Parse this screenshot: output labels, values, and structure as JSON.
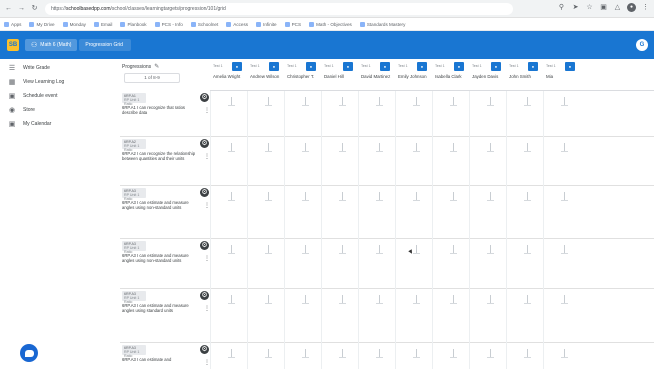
{
  "browser": {
    "url_prefix": "https://",
    "url_domain": "schoolbasedpp.com",
    "url_path": "/school/classes/learningtargets/progression/101/grid",
    "bookmarks": [
      {
        "label": "Apps",
        "icon": "apps-icon"
      },
      {
        "label": "My Drive",
        "icon": "drive-icon"
      },
      {
        "label": "Monday",
        "icon": "calendar-icon"
      },
      {
        "label": "Email",
        "icon": "mail-icon"
      },
      {
        "label": "Planbook",
        "icon": "book-icon"
      },
      {
        "label": "PCS - Info",
        "icon": "bookmark-icon"
      },
      {
        "label": "Schoolnet",
        "icon": "bookmark-icon"
      },
      {
        "label": "Access",
        "icon": "bookmark-icon"
      },
      {
        "label": "Infinite",
        "icon": "bookmark-icon"
      },
      {
        "label": "PCS",
        "icon": "bookmark-icon"
      },
      {
        "label": "Math - Objectives",
        "icon": "bookmark-icon"
      },
      {
        "label": "Standards Mastery",
        "icon": "bookmark-icon"
      }
    ]
  },
  "header": {
    "logo_text": "SB",
    "tab_label": "Math 6 (Math)",
    "subtab_label": "Progression Grid",
    "user_initial": "G"
  },
  "sidebar": {
    "items": [
      {
        "label": "Write Grade",
        "icon": "list-icon",
        "active": false
      },
      {
        "label": "View Learning Log",
        "icon": "log-icon",
        "active": false
      },
      {
        "label": "Schedule event",
        "icon": "calendar-icon",
        "active": false
      },
      {
        "label": "Store",
        "icon": "lock-icon",
        "active": false
      },
      {
        "label": "My Calendar",
        "icon": "calendar-icon",
        "active": false
      }
    ],
    "fab_icon": "chat-icon"
  },
  "progression": {
    "title": "Progressions",
    "select_value": "1 of 8-9"
  },
  "students": [
    {
      "label": "Test 1",
      "name": "Amelia Wright"
    },
    {
      "label": "Test 1",
      "name": "Andrew Wilson"
    },
    {
      "label": "Test 1",
      "name": "Christopher T."
    },
    {
      "label": "Test 1",
      "name": "Daniel Hill"
    },
    {
      "label": "Test 1",
      "name": "David Martinez"
    },
    {
      "label": "Test 1",
      "name": "Emily Johnson"
    },
    {
      "label": "Test 1",
      "name": "Isabella Clark"
    },
    {
      "label": "Test 1",
      "name": "Jayden Davis"
    },
    {
      "label": "Test 1",
      "name": "John Smith"
    },
    {
      "label": "Test 1",
      "name": "Mia"
    }
  ],
  "targets": [
    {
      "tag": "6RP.A1",
      "sub": "RP Unit 1 Ratio",
      "text": "6RP.A1 I can recognize that ratios describe data"
    },
    {
      "tag": "6RP.A2",
      "sub": "RP Unit 1 Ratio",
      "text": "6RP.A2 I can recognize the relationship between quantities and their units"
    },
    {
      "tag": "6RP.A3",
      "sub": "RP Unit 1 Ratio",
      "text": "6RP.A3 I can estimate and measure angles using non-standard units"
    },
    {
      "tag": "6RP.A3",
      "sub": "RP Unit 1 Ratio",
      "text": "6RP.A3 I can estimate and measure angles using non-standard units"
    },
    {
      "tag": "6RP.A3",
      "sub": "RP Unit 1 Ratio",
      "text": "6RP.A3 I can estimate and measure angles using standard units"
    },
    {
      "tag": "6RP.A3",
      "sub": "RP Unit 1 Ratio",
      "text": "6RP.A3 I can estimate and"
    }
  ]
}
